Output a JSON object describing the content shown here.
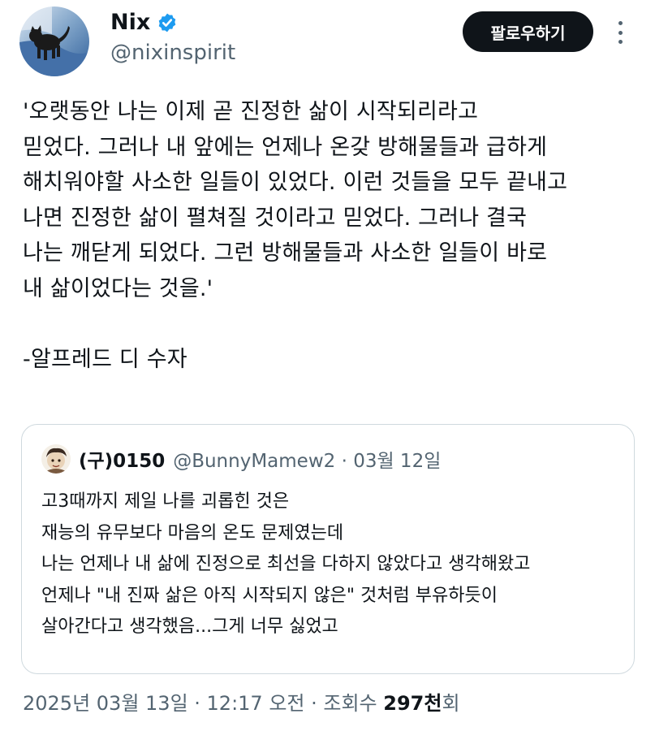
{
  "author": {
    "name": "Nix",
    "handle": "@nixinspirit",
    "verified": true
  },
  "follow_button": "팔로우하기",
  "more_icon": "more-vertical-icon",
  "tweet": {
    "lines": [
      "'오랫동안 나는 이제 곧 진정한 삶이 시작되리라고",
      "믿었다. 그러나 내 앞에는 언제나 온갖 방해물들과 급하게",
      "해치워야할 사소한 일들이 있었다. 이런 것들을 모두 끝내고",
      "나면 진정한 삶이 펼쳐질 것이라고 믿었다. 그러나 결국",
      "나는 깨닫게 되었다. 그런 방해물들과 사소한 일들이 바로",
      "내 삶이었다는 것을.'",
      "",
      "-알프레드 디 수자"
    ]
  },
  "quote": {
    "name": "(구)0150",
    "handle_date": "@BunnyMamew2 · 03월 12일",
    "lines": [
      "고3때까지 제일 나를 괴롭힌 것은",
      "재능의 유무보다 마음의 온도 문제였는데",
      "나는 언제나 내 삶에 진정으로 최선을 다하지 않았다고 생각해왔고",
      "언제나 \"내 진짜 삶은 아직 시작되지 않은\" 것처럼 부유하듯이",
      "살아간다고 생각했음...그게 너무 싫었고"
    ]
  },
  "meta": {
    "datetime": "2025년 03월 13일 · 12:17 오전 · 조회수 ",
    "views": "297천",
    "views_suffix": "회"
  },
  "colors": {
    "text": "#0f1419",
    "secondary": "#536471",
    "verified": "#1d9bf0",
    "border": "#cfd9de"
  }
}
